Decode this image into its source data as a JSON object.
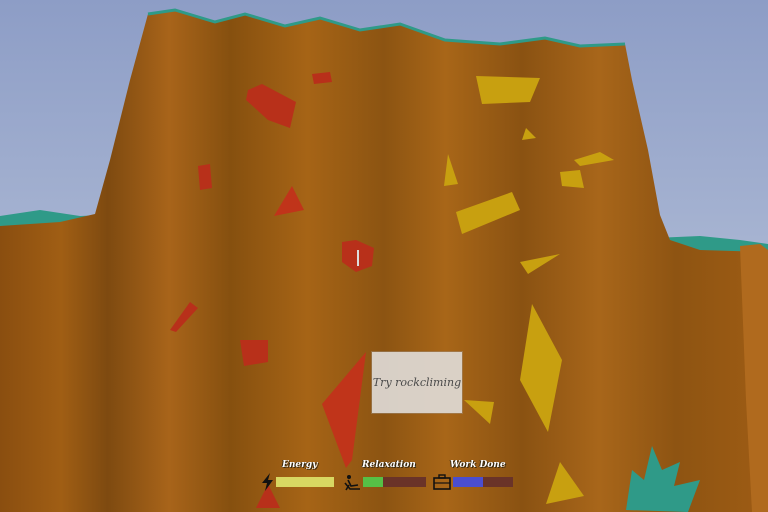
{
  "sign": {
    "text": "Try rockcliming"
  },
  "hud": {
    "energy": {
      "label": "Energy",
      "icon": "lightning-icon",
      "level": 1.0,
      "color": "#d8d862",
      "track_color": "#6a3328"
    },
    "relaxation": {
      "label": "Relaxation",
      "icon": "lounge-chair-icon",
      "level": 0.32,
      "color": "#56c046",
      "track_color": "#6a3328"
    },
    "work_done": {
      "label": "Work Done",
      "icon": "briefcase-icon",
      "level": 0.5,
      "color": "#4a4ed0",
      "track_color": "#6a3328"
    }
  },
  "colors": {
    "sky": "#a9b6d6",
    "cliff": "#9a5a12",
    "grass": "#2f9a88",
    "hold_red": "#b8301a",
    "hold_yellow": "#c8a010"
  }
}
